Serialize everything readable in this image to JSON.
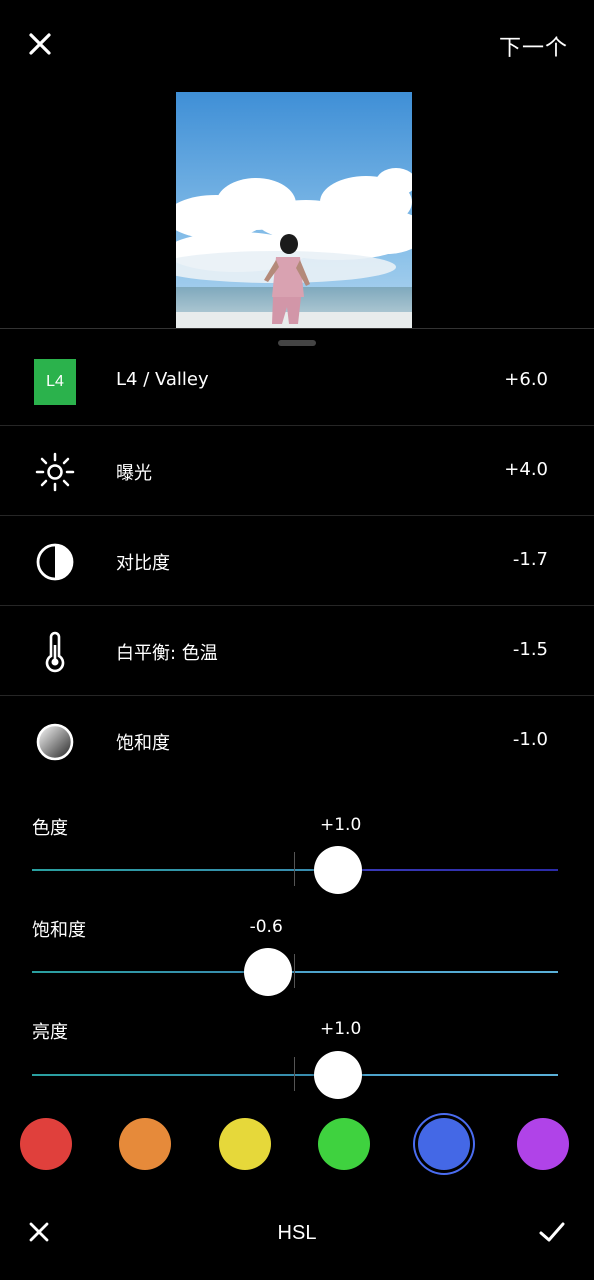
{
  "header": {
    "next_label": "下一个"
  },
  "adjustments": [
    {
      "label": "L4 / Valley",
      "value": "+6.0",
      "badge": "L4",
      "icon": "preset-badge"
    },
    {
      "label": "曝光",
      "value": "+4.0",
      "icon": "sun-icon"
    },
    {
      "label": "对比度",
      "value": "-1.7",
      "icon": "contrast-icon"
    },
    {
      "label": "白平衡: 色温",
      "value": "-1.5",
      "icon": "thermometer-icon"
    },
    {
      "label": "饱和度",
      "value": "-1.0",
      "icon": "saturation-icon"
    }
  ],
  "hsl": {
    "sliders": [
      {
        "label": "色度",
        "value": "+1.0",
        "level": 1.0
      },
      {
        "label": "饱和度",
        "value": "-0.6",
        "level": -0.6
      },
      {
        "label": "亮度",
        "value": "+1.0",
        "level": 1.0
      }
    ],
    "colors": [
      "#e0403c",
      "#e68a3a",
      "#e6d83a",
      "#3fd23f",
      "#4468e6",
      "#b043e8"
    ],
    "selected_color_index": 4
  },
  "footer": {
    "title": "HSL"
  }
}
